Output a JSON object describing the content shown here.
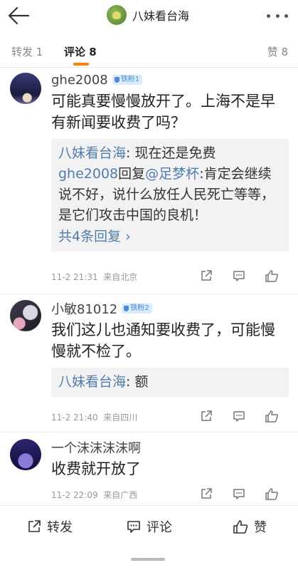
{
  "header": {
    "title": "八妹看台海",
    "back_icon": "arrow-left-icon",
    "more_icon": "more-dots-icon"
  },
  "tabs": {
    "repost": "转发 1",
    "comment": "评论 8",
    "like": "赞 8",
    "accent": "#ff8200"
  },
  "comments": [
    {
      "name": "ghe2008",
      "badge": "铁粉1",
      "text": "可能真要慢慢放开了。上海不是早有新闻要收费了吗？",
      "replies": [
        {
          "name": "八妹看台海",
          "text": ": 现在还是免费"
        },
        {
          "name": "ghe2008",
          "reply_word": "回复",
          "mention": "@足梦杯",
          "text": ":肯定会继续说不好，说什么放任人民死亡等等，是它们攻击中国的良机！"
        }
      ],
      "more_replies": "共4条回复 ›",
      "time": "11-2 21:31",
      "location": "来自北京"
    },
    {
      "name": "小敏81012",
      "badge": "铁粉2",
      "text": "我们这儿也通知要收费了，可能慢慢就不检了。",
      "replies": [
        {
          "name": "八妹看台海",
          "text": ": 额"
        }
      ],
      "time": "11-2 21:40",
      "location": "来自四川"
    },
    {
      "name": "一个沫沫沫沫啊",
      "text": "收费就开放了",
      "time": "11-2 22:09",
      "location": "来自广西"
    }
  ],
  "bottom": {
    "repost": "转发",
    "comment": "评论",
    "like": "赞"
  },
  "colors": {
    "link": "#507daf",
    "badge_bg": "#d9ecff",
    "badge_text": "#4a8be0"
  }
}
